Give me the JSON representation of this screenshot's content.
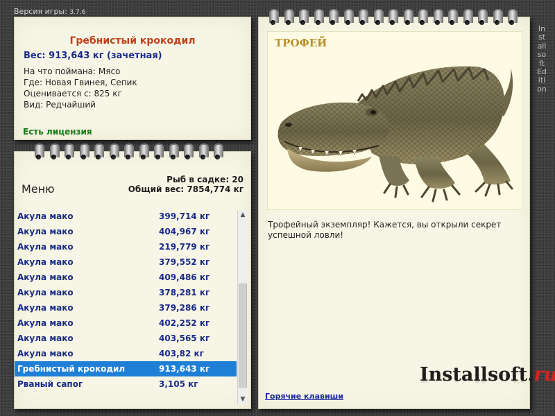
{
  "app": {
    "version_label": "Версия игры:",
    "version_number": "3.7.6",
    "side_label": "InstallsoftEdition"
  },
  "catch_info": {
    "title": "Гребнистый крокодил",
    "weight": "Вес: 913,643 кг (зачетная)",
    "bait": "На что поймана: Мясо",
    "location": "Где: Новая Гвинея, Сепик",
    "valued_from": "Оценивается с: 825 кг",
    "kind": "Вид: Редчайший",
    "license": "Есть лицензия"
  },
  "keepnet": {
    "menu_label": "Меню",
    "fish_count": "Рыб в садке: 20",
    "total_weight": "Общий вес: 7854,774 кг",
    "selected_index": 10,
    "items": [
      {
        "name": "Акула мако",
        "weight": "399,714 кг"
      },
      {
        "name": "Акула мако",
        "weight": "404,967 кг"
      },
      {
        "name": "Акула мако",
        "weight": "219,779 кг"
      },
      {
        "name": "Акула мако",
        "weight": "379,552 кг"
      },
      {
        "name": "Акула мако",
        "weight": "409,486 кг"
      },
      {
        "name": "Акула мако",
        "weight": "378,281 кг"
      },
      {
        "name": "Акула мако",
        "weight": "379,286 кг"
      },
      {
        "name": "Акула мако",
        "weight": "402,252 кг"
      },
      {
        "name": "Акула мако",
        "weight": "403,565 кг"
      },
      {
        "name": "Акула мако",
        "weight": "403,82 кг"
      },
      {
        "name": "Гребнистый крокодил",
        "weight": "913,643 кг"
      },
      {
        "name": "Рваный сапог",
        "weight": "3,105 кг"
      }
    ]
  },
  "trophy": {
    "label": "ТРОФЕЙ",
    "description": "Трофейный экземпляр! Кажется, вы открыли секрет успешной ловли!",
    "hotkeys_link": "Горячие клавиши",
    "logo_main": "Installsoft.",
    "logo_tld": "ru"
  },
  "icons": {
    "scroll_up": "▲",
    "scroll_down": "▼"
  },
  "colors": {
    "accent_title": "#c0401a",
    "item_text": "#1a2a8a",
    "selection": "#1f7fd6",
    "license": "#137a13",
    "trophy_label": "#b89028",
    "logo_tld": "#d42222"
  }
}
